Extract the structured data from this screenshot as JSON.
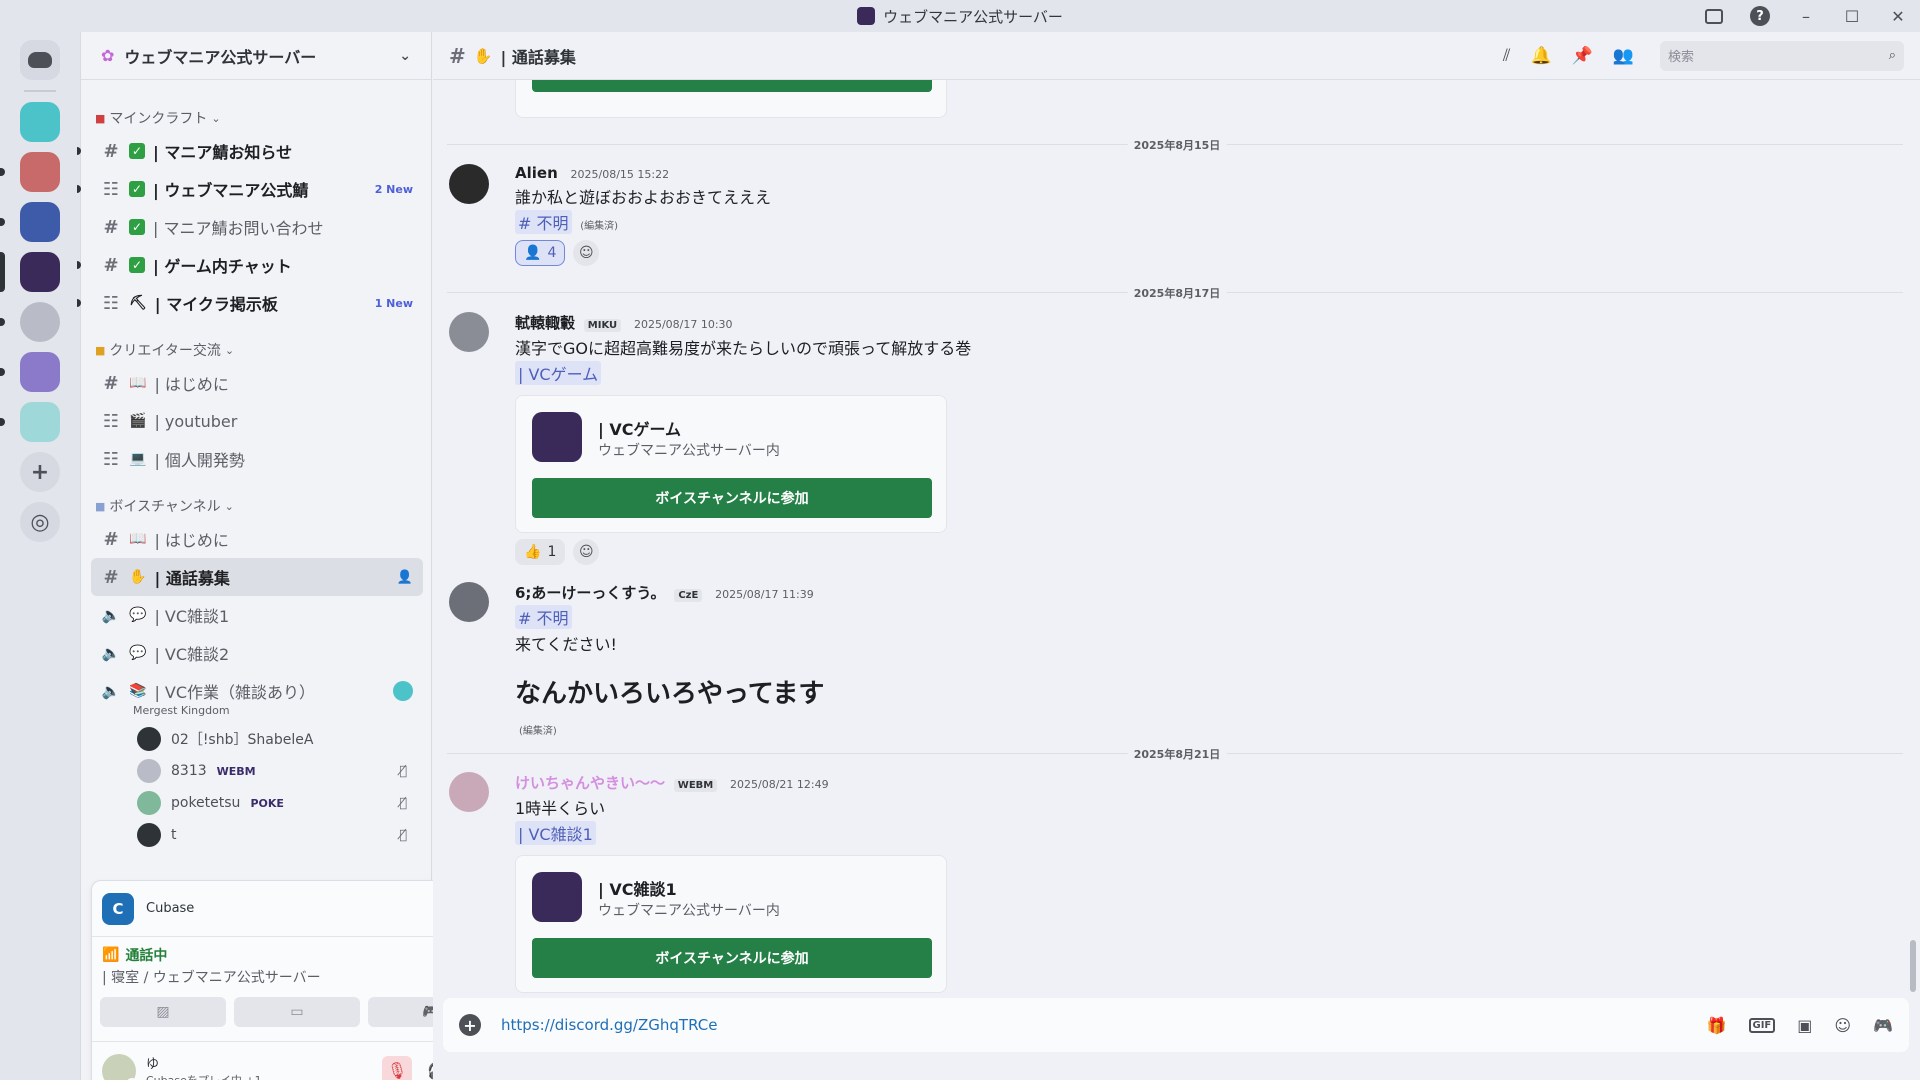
{
  "window": {
    "title": "ウェブマニア公式サーバー"
  },
  "server": {
    "name": "ウェブマニア公式サーバー"
  },
  "categories": {
    "minecraft": "マインクラフト",
    "creator": "クリエイター交流",
    "voice": "ボイスチャンネル"
  },
  "channels": {
    "mc1": "| マニア鯖お知らせ",
    "mc2": "| ウェブマニア公式鯖",
    "mc2_badge": "2 New",
    "mc3": "| マニア鯖お問い合わせ",
    "mc4": "| ゲーム内チャット",
    "mc5": "| マイクラ掲示板",
    "mc5_badge": "1 New",
    "cr1": "| はじめに",
    "cr2": "| youtuber",
    "cr3": "| 個人開発勢",
    "v1": "| はじめに",
    "v2": "| 通話募集",
    "v3": "| VC雑談1",
    "v4": "| VC雑談2",
    "v5": "| VC作業（雑談あり）",
    "v5_sub": "Mergest Kingdom"
  },
  "voice_users": [
    {
      "name": "02［!shb］ShabeleA",
      "tag": ""
    },
    {
      "name": "8313",
      "tag": "WEBM"
    },
    {
      "name": "poketetsu",
      "tag": "POKE"
    },
    {
      "name": "t",
      "tag": ""
    }
  ],
  "activity": {
    "app": "Cubase"
  },
  "voice_status": {
    "state": "通話中",
    "channel": "| 寝室 / ウェブマニア公式サーバー"
  },
  "me": {
    "name": "ゆ",
    "status": "Cubaseをプレイ中 +1"
  },
  "header": {
    "channel": "| 通話募集",
    "search_placeholder": "検索"
  },
  "dates": [
    "2025年8月15日",
    "2025年8月17日",
    "2025年8月21日"
  ],
  "messages": [
    {
      "user": "Alien",
      "time": "2025/08/15 15:22",
      "text": "誰か私と遊ぼおおよおおきてえええ",
      "mention": "# 不明",
      "edited": "(編集済)",
      "reaction_count": "4"
    },
    {
      "user": "軾轅輙轂",
      "tag": "MIKU",
      "time": "2025/08/17 10:30",
      "text": "漢字でGOに超超高難易度が来たらしいので頑張って解放する巻",
      "mention": "| VCゲーム",
      "card_name": "| VCゲーム",
      "card_sub": "ウェブマニア公式サーバー内",
      "join": "ボイスチャンネルに参加",
      "reaction_count": "1"
    },
    {
      "user": "6;あーけーっくすう。",
      "tag": "CzE",
      "time": "2025/08/17 11:39",
      "mention": "# 不明",
      "text": "来てください!",
      "big": "なんかいろいろやってます",
      "edited": "(編集済)"
    },
    {
      "user": "けいちゃんやきい〜〜",
      "tag": "WEBM",
      "time": "2025/08/21 12:49",
      "text": "1時半くらい",
      "mention": "| VC雑談1",
      "card_name": "| VC雑談1",
      "card_sub": "ウェブマニア公式サーバー内",
      "join": "ボイスチャンネルに参加"
    }
  ],
  "composer": {
    "value": "https://discord.gg/ZGhqTRCe"
  },
  "colors": {
    "join_green": "#248046",
    "mention_bg": "#dde2f7",
    "online": "#23a55a"
  }
}
